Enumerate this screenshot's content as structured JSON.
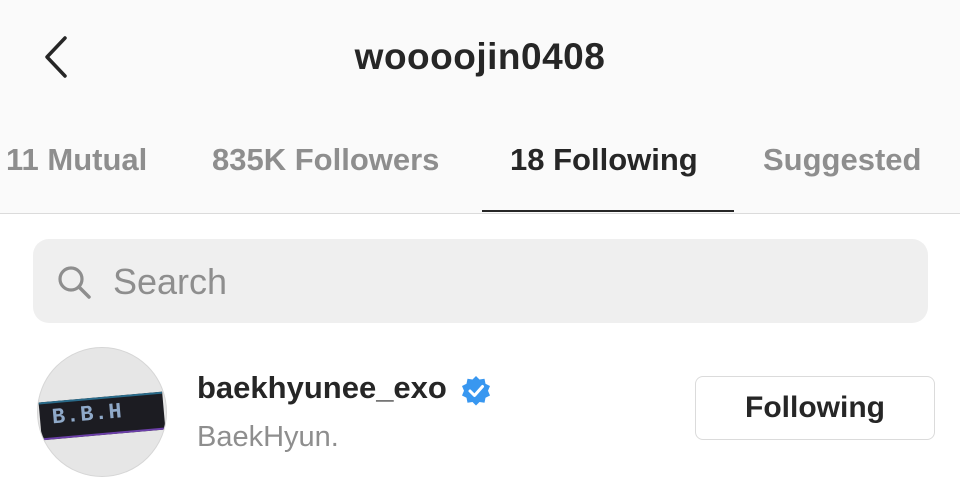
{
  "header": {
    "title": "woooojin0408",
    "back_icon": "chevron-left-icon"
  },
  "tabs": [
    {
      "label": "11 Mutual",
      "active": false
    },
    {
      "label": "835K Followers",
      "active": false
    },
    {
      "label": "18 Following",
      "active": true
    },
    {
      "label": "Suggested",
      "active": false
    }
  ],
  "search": {
    "placeholder": "Search",
    "value": "",
    "icon": "search-icon"
  },
  "list": [
    {
      "username": "baekhyunee_exo",
      "verified": true,
      "full_name": "BaekHyun.",
      "avatar_text": "B.B.H",
      "button_label": "Following"
    }
  ],
  "colors": {
    "header_bg": "#fafafa",
    "text_primary": "#262626",
    "text_secondary": "#8e8e8e",
    "verified_blue": "#3897f0",
    "search_bg": "#efefef",
    "border": "#dbdbdb"
  }
}
